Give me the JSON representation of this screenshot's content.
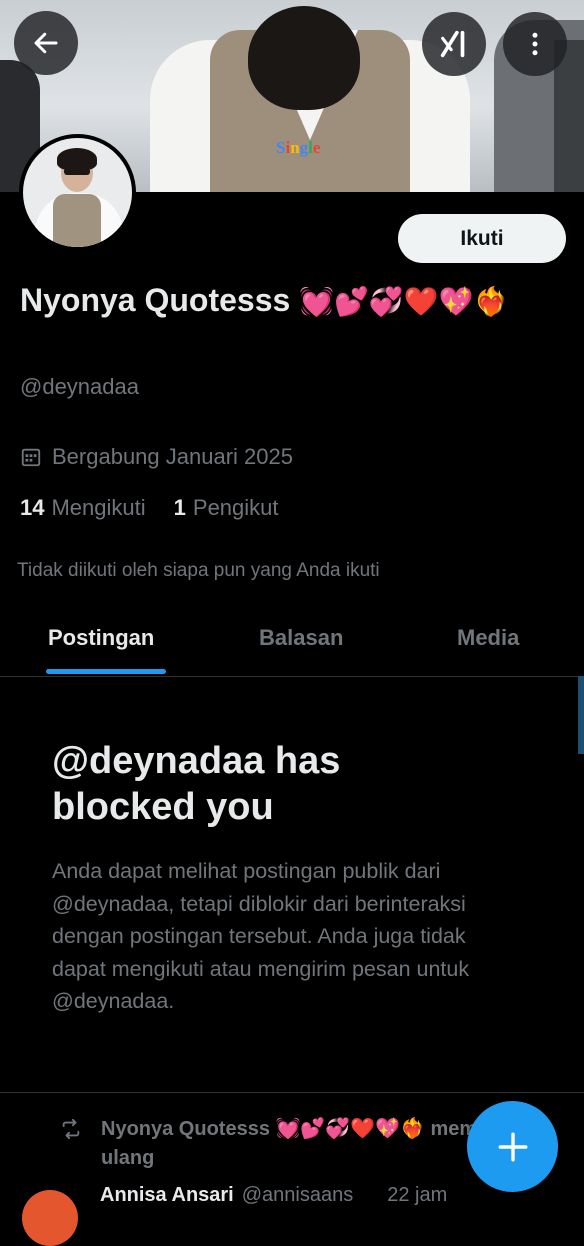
{
  "banner": {
    "shirt_text": "Single"
  },
  "header": {
    "back_icon": "arrow-left-icon",
    "grok_icon": "grok-icon",
    "more_icon": "more-vertical-icon"
  },
  "profile": {
    "follow_label": "Ikuti",
    "display_name": "Nyonya Quotesss",
    "name_emojis": "💓💕💞❤️💖❤️‍🔥",
    "handle": "@deynadaa",
    "joined": "Bergabung Januari 2025",
    "following_count": "14",
    "following_label": "Mengikuti",
    "followers_count": "1",
    "followers_label": "Pengikut",
    "not_followed_note": "Tidak diikuti oleh siapa pun yang Anda ikuti"
  },
  "tabs": [
    {
      "label": "Postingan",
      "active": true
    },
    {
      "label": "Balasan",
      "active": false
    },
    {
      "label": "Media",
      "active": false
    }
  ],
  "blocked": {
    "title": "@deynadaa has blocked you",
    "body": "Anda dapat melihat postingan publik dari @deynadaa, tetapi diblokir dari berinteraksi dengan postingan tersebut. Anda juga tidak dapat mengikuti atau mengirim pesan untuk @deynadaa."
  },
  "feed": {
    "repost_text": "Nyonya Quotesss 💓💕💞❤️💖❤️‍🔥 memposting ulang",
    "next_name": "Annisa Ansari",
    "next_handle": "@annisaans",
    "next_time": "22 jam"
  },
  "colors": {
    "accent": "#1d9bf0",
    "background": "#000000",
    "muted_text": "#71767b",
    "primary_text": "#e7e9ea"
  }
}
